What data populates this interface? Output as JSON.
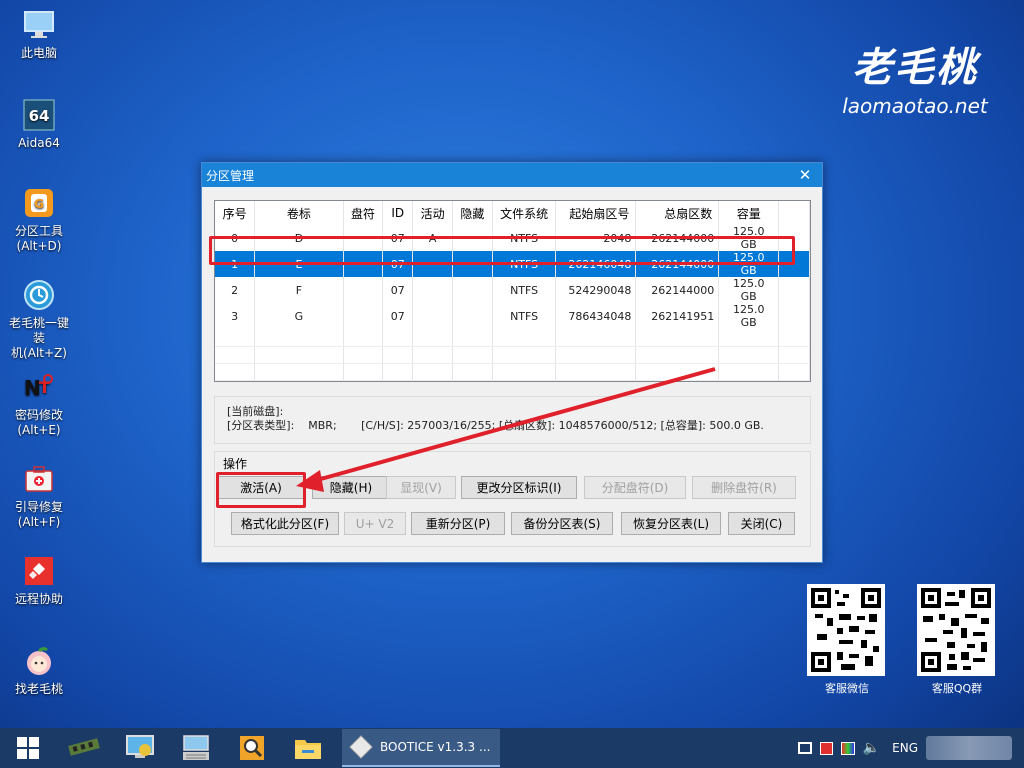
{
  "desktop": {
    "icons": [
      {
        "name": "this-pc",
        "label": "此电脑",
        "icon": "monitor-icon"
      },
      {
        "name": "aida64",
        "label": "Aida64",
        "icon": "aida64-icon"
      },
      {
        "name": "partition-tool",
        "label": "分区工具\n(Alt+D)",
        "icon": "diskgenius-icon"
      },
      {
        "name": "one-key-install",
        "label": "老毛桃一键装\n机(Alt+Z)",
        "icon": "restore-icon"
      },
      {
        "name": "password-change",
        "label": "密码修改\n(Alt+E)",
        "icon": "ntpwd-icon"
      },
      {
        "name": "boot-repair",
        "label": "引导修复\n(Alt+F)",
        "icon": "medkit-icon"
      },
      {
        "name": "remote-assist",
        "label": "远程协助",
        "icon": "anydesk-icon"
      },
      {
        "name": "find-laomaotao",
        "label": "找老毛桃",
        "icon": "peach-icon"
      }
    ],
    "brand": {
      "logo": "老毛桃",
      "url": "laomaotao.net"
    },
    "qr": [
      {
        "label": "客服微信"
      },
      {
        "label": "客服QQ群"
      }
    ]
  },
  "dialog": {
    "title": "分区管理",
    "columns": [
      "序号",
      "卷标",
      "盘符",
      "ID",
      "活动",
      "隐藏",
      "文件系统",
      "起始扇区号",
      "总扇区数",
      "容量"
    ],
    "rows": [
      [
        "0",
        "D",
        "",
        "07",
        "A",
        "",
        "NTFS",
        "2048",
        "262144000",
        "125.0 GB"
      ],
      [
        "1",
        "E",
        "",
        "07",
        "",
        "",
        "NTFS",
        "262146048",
        "262144000",
        "125.0 GB"
      ],
      [
        "2",
        "F",
        "",
        "07",
        "",
        "",
        "NTFS",
        "524290048",
        "262144000",
        "125.0 GB"
      ],
      [
        "3",
        "G",
        "",
        "07",
        "",
        "",
        "NTFS",
        "786434048",
        "262141951",
        "125.0 GB"
      ]
    ],
    "selected_row": 1,
    "info": {
      "current_disk": "[当前磁盘]:",
      "details": "[分区表类型]:    MBR;       [C/H/S]: 257003/16/255; [总扇区数]: 1048576000/512; [总容量]: 500.0 GB."
    },
    "ops_legend": "操作",
    "buttons_row1": [
      {
        "label": "激活(A)",
        "enabled": true
      },
      {
        "label": "隐藏(H)",
        "enabled": true
      },
      {
        "label": "显现(V)",
        "enabled": false
      },
      {
        "label": "更改分区标识(I)",
        "enabled": true
      },
      {
        "label": "分配盘符(D)",
        "enabled": false
      },
      {
        "label": "删除盘符(R)",
        "enabled": false
      }
    ],
    "buttons_row2": [
      {
        "label": "格式化此分区(F)",
        "enabled": true
      },
      {
        "label": "U+ V2",
        "enabled": false
      },
      {
        "label": "重新分区(P)",
        "enabled": true
      },
      {
        "label": "备份分区表(S)",
        "enabled": true
      },
      {
        "label": "恢复分区表(L)",
        "enabled": true
      },
      {
        "label": "关闭(C)",
        "enabled": true
      }
    ]
  },
  "taskbar": {
    "active_app": "BOOTICE v1.3.3 ...",
    "lang": "ENG"
  },
  "colors": {
    "highlight": "#e0202a",
    "selection": "#0078d7",
    "titlebar": "#1883d7"
  }
}
